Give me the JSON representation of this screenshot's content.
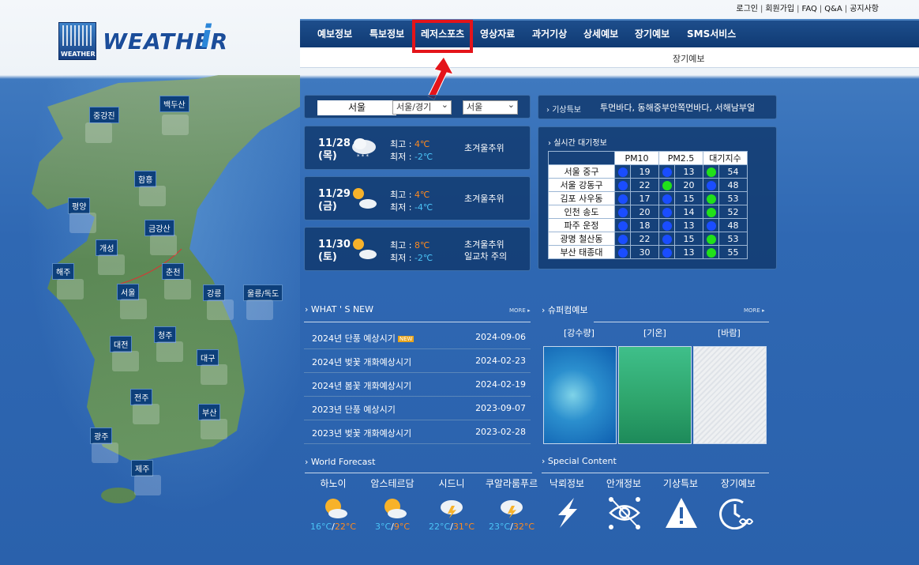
{
  "top_links": [
    "로그인",
    "회원가입",
    "FAQ",
    "Q&A",
    "공지사항"
  ],
  "logo": {
    "box_text": "WEATHER",
    "word": "WEATHER",
    "i": "i"
  },
  "nav": {
    "items": [
      "예보정보",
      "특보정보",
      "레저스포츠",
      "영상자료",
      "과거기상",
      "상세예보",
      "장기예보",
      "SMS서비스"
    ],
    "highlighted": "레저스포츠",
    "sub": "장기예보"
  },
  "map_cities": [
    "중강진",
    "백두산",
    "함흥",
    "평양",
    "금강산",
    "개성",
    "해주",
    "춘천",
    "서울",
    "강릉",
    "울릉/독도",
    "청주",
    "대전",
    "대구",
    "전주",
    "부산",
    "광주",
    "제주"
  ],
  "location": {
    "city": "서울",
    "region_select": "서울/경기",
    "city_select": "서울"
  },
  "forecast": [
    {
      "date": "11/28",
      "dow": "(목)",
      "hi_label": "최고 : ",
      "hi": "4℃",
      "lo_label": "최저 : ",
      "lo": "-2℃",
      "desc1": "초겨울추위",
      "desc2": ""
    },
    {
      "date": "11/29",
      "dow": "(금)",
      "hi_label": "최고 : ",
      "hi": "4℃",
      "lo_label": "최저 : ",
      "lo": "-4℃",
      "desc1": "초겨울추위",
      "desc2": ""
    },
    {
      "date": "11/30",
      "dow": "(토)",
      "hi_label": "최고 : ",
      "hi": "8℃",
      "lo_label": "최저 : ",
      "lo": "-2℃",
      "desc1": "초겨울추위",
      "desc2": "일교차 주의"
    }
  ],
  "warning": {
    "label": "기상특보",
    "text": "투먼바다, 동해중부안쪽먼바다, 서해남부얼"
  },
  "air": {
    "title": "실시간 대기정보",
    "headers": [
      "PM10",
      "PM2.5",
      "대기지수"
    ],
    "rows": [
      {
        "name": "서울 중구",
        "pm10": "19",
        "pm25": "13",
        "idx": "54",
        "c1": "#1a4dff",
        "c2": "#1a4dff",
        "c3": "#21e01a"
      },
      {
        "name": "서울 강동구",
        "pm10": "22",
        "pm25": "20",
        "idx": "48",
        "c1": "#1a4dff",
        "c2": "#21e01a",
        "c3": "#1a4dff"
      },
      {
        "name": "김포 사우동",
        "pm10": "17",
        "pm25": "15",
        "idx": "53",
        "c1": "#1a4dff",
        "c2": "#1a4dff",
        "c3": "#21e01a"
      },
      {
        "name": "인천 송도",
        "pm10": "20",
        "pm25": "14",
        "idx": "52",
        "c1": "#1a4dff",
        "c2": "#1a4dff",
        "c3": "#21e01a"
      },
      {
        "name": "파주 운정",
        "pm10": "18",
        "pm25": "13",
        "idx": "48",
        "c1": "#1a4dff",
        "c2": "#1a4dff",
        "c3": "#1a4dff"
      },
      {
        "name": "광명 철산동",
        "pm10": "22",
        "pm25": "15",
        "idx": "53",
        "c1": "#1a4dff",
        "c2": "#1a4dff",
        "c3": "#21e01a"
      },
      {
        "name": "부산 태종대",
        "pm10": "30",
        "pm25": "13",
        "idx": "55",
        "c1": "#1a4dff",
        "c2": "#1a4dff",
        "c3": "#21e01a"
      }
    ]
  },
  "whats_new": {
    "title": "WHAT ' S NEW",
    "more": "MORE",
    "badge": "NEW",
    "items": [
      {
        "title": "2024년 단풍 예상시기",
        "date": "2024-09-06",
        "new": true
      },
      {
        "title": "2024년 벚꽃 개화예상시기",
        "date": "2024-02-23",
        "new": false
      },
      {
        "title": "2024년 봄꽃 개화예상시기",
        "date": "2024-02-19",
        "new": false
      },
      {
        "title": "2023년 단풍 예상시기",
        "date": "2023-09-07",
        "new": false
      },
      {
        "title": "2023년 벚꽃 개화예상시기",
        "date": "2023-02-28",
        "new": false
      }
    ]
  },
  "supercom": {
    "title": "슈퍼컴예보",
    "more": "MORE",
    "tabs": [
      "[강수량]",
      "[기온]",
      "[바람]"
    ]
  },
  "world": {
    "title": "World Forecast",
    "cities": [
      {
        "name": "하노이",
        "lo": "16°C",
        "hi": "22°C"
      },
      {
        "name": "암스테르담",
        "lo": "3°C",
        "hi": "9°C"
      },
      {
        "name": "시드니",
        "lo": "22°C",
        "hi": "31°C"
      },
      {
        "name": "쿠알라룸푸르",
        "lo": "23°C",
        "hi": "32°C"
      }
    ]
  },
  "special": {
    "title": "Special Content",
    "items": [
      "낙뢰정보",
      "안개정보",
      "기상특보",
      "장기예보"
    ]
  },
  "colors": {
    "nav": "#123f78",
    "panel": "#10386c",
    "highlight": "#e4141a",
    "hot": "#ff8a1e",
    "cold": "#4bc3f5"
  }
}
